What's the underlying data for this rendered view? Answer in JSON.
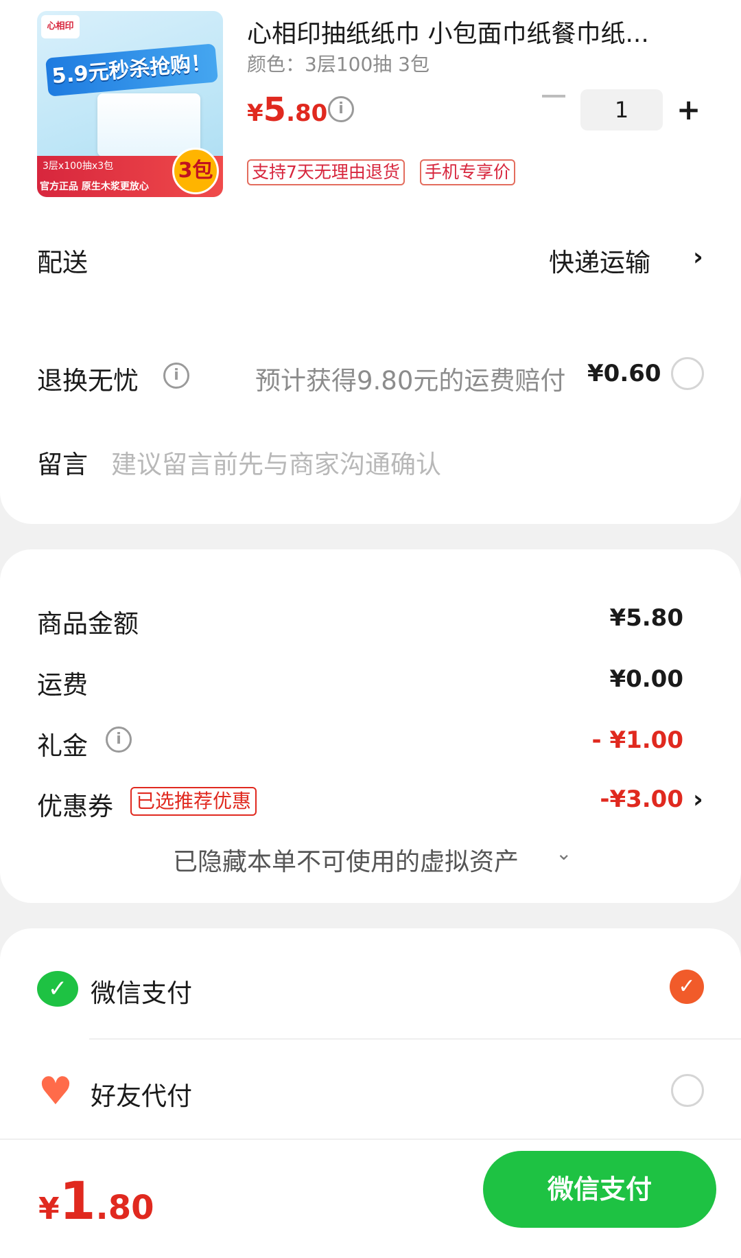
{
  "product": {
    "title": "心相印抽纸纸巾 小包面巾纸餐巾纸...",
    "variant": "颜色：3层100抽 3包",
    "price_currency": "¥",
    "price_int": "5",
    "price_dec": ".80",
    "quantity": "1",
    "tags": [
      "支持7天无理由退货",
      "手机专享价"
    ],
    "image": {
      "logo": "心相印",
      "banner": "5.9元秒杀抢购！",
      "strip_line1": "3层x100抽x3包",
      "strip_line2": "官方正品 原生木浆更放心",
      "badge": "3包"
    }
  },
  "delivery": {
    "label": "配送",
    "value": "快递运输"
  },
  "return_insurance": {
    "label": "退换无忧",
    "desc": "预计获得9.80元的运费赔付",
    "price": "¥0.60"
  },
  "message": {
    "label": "留言",
    "placeholder": "建议留言前先与商家沟通确认"
  },
  "summary": {
    "goods_label": "商品金额",
    "goods_value": "¥5.80",
    "shipping_label": "运费",
    "shipping_value": "¥0.00",
    "gift_label": "礼金",
    "gift_value": "- ¥1.00",
    "coupon_label": "优惠券",
    "coupon_tag": "已选推荐优惠",
    "coupon_value": "-¥3.00",
    "hidden_assets": "已隐藏本单不可使用的虚拟资产"
  },
  "payment": {
    "wechat_label": "微信支付",
    "friend_label": "好友代付"
  },
  "footer": {
    "total_currency": "¥",
    "total_int": "1",
    "total_dec": ".80",
    "pay_button": "微信支付"
  },
  "colors": {
    "accent_red": "#e0291f",
    "wechat_green": "#1ec243",
    "check_orange": "#f15b2a"
  },
  "icons": [
    "info-icon",
    "chevron-right-icon",
    "chevron-down-icon",
    "wechat-icon",
    "heart-yen-icon",
    "check-icon",
    "minus-icon",
    "plus-icon"
  ]
}
